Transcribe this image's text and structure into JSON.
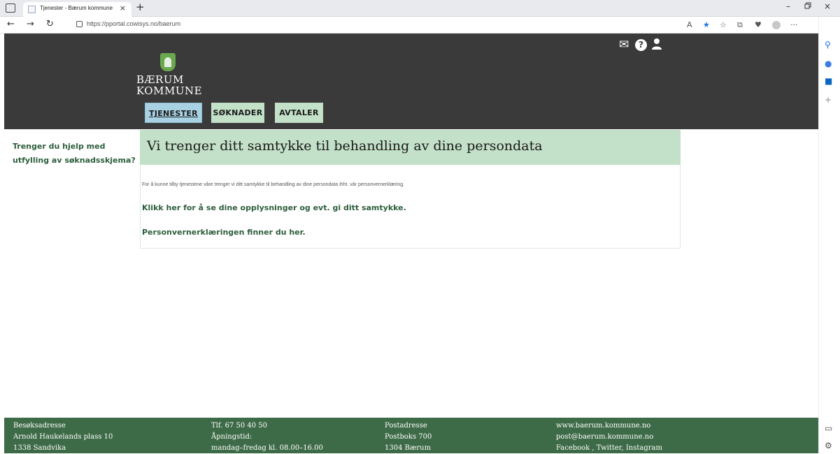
{
  "browser": {
    "tab_title": "Tjenester - Bærum kommune",
    "tab_close": "×",
    "new_tab": "+",
    "url": "https://pportal.cowisys.no/baerum",
    "window_minimize": "–",
    "window_restore": "▫",
    "window_close": "×"
  },
  "header": {
    "logo_line1": "BÆRUM",
    "logo_line2": "KOMMUNE",
    "icons": [
      "mail-icon",
      "help-icon",
      "user-icon"
    ]
  },
  "nav": {
    "tabs": [
      {
        "label": "TJENESTER",
        "active": true
      },
      {
        "label": "SØKNADER",
        "active": false
      },
      {
        "label": "AVTALER",
        "active": false
      }
    ]
  },
  "sidebar": {
    "help_text": "Trenger du hjelp med utfylling av søknadsskjema?"
  },
  "main": {
    "title": "Vi trenger ditt samtykke til behandling av dine persondata",
    "note": "For å kunne tilby tjenestene våre trenger vi ditt samtykke til behandling av dine persondata ihht. vår personvernerklæring.",
    "link_consent": "Klikk her for å se dine opplysninger og evt. gi ditt samtykke.",
    "link_privacy": "Personvernerklæringen finner du her."
  },
  "footer": {
    "col1": [
      "Besøksadresse",
      "Arnold Haukelands plass 10",
      "1338 Sandvika"
    ],
    "col2": [
      "Tlf. 67 50 40 50",
      "Åpningstid:",
      "mandag–fredag kl. 08.00–16.00"
    ],
    "col3": [
      "Postadresse",
      "Postboks 700",
      "1304 Bærum"
    ],
    "col4": [
      "www.baerum.kommune.no",
      "post@baerum.kommune.no",
      "Facebook , Twitter, Instagram"
    ]
  },
  "colors": {
    "header_bg": "#3a3a3a",
    "accent_green": "#c3e0c8",
    "active_tab": "#a8d2e3",
    "link_green": "#2d5e3c",
    "footer_bg": "#3e6b47"
  }
}
